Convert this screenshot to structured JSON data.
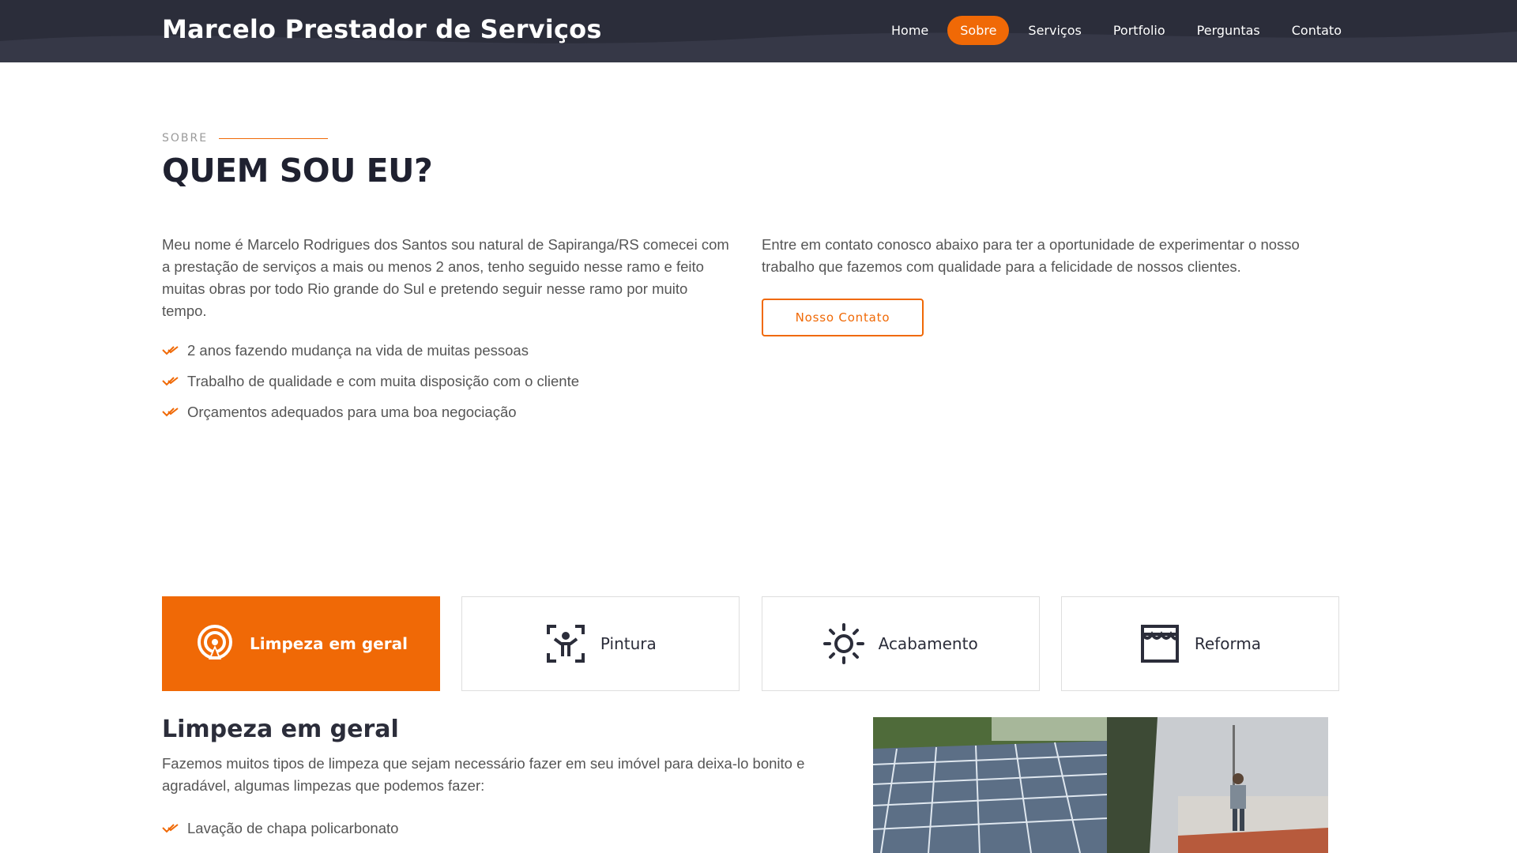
{
  "header": {
    "logo": "Marcelo Prestador de Serviços",
    "nav": [
      "Home",
      "Sobre",
      "Serviços",
      "Portfolio",
      "Perguntas",
      "Contato"
    ],
    "active_nav": "Sobre"
  },
  "about": {
    "label": "SOBRE",
    "title": "QUEM SOU EU?",
    "paragraph": "Meu nome é Marcelo Rodrigues dos Santos sou natural de Sapiranga/RS comecei com a prestação de serviços a mais ou menos 2 anos, tenho seguido nesse ramo e feito muitas obras por todo Rio grande do Sul e pretendo seguir nesse ramo por muito tempo.",
    "checks": [
      "2 anos fazendo mudança na vida de muitas pessoas",
      "Trabalho de qualidade e com muita disposição com o cliente",
      "Orçamentos adequados para uma boa negociação"
    ],
    "contact_text": "Entre em contato conosco abaixo para ter a oportunidade de experimentar o nosso trabalho que fazemos com qualidade para a felicidade de nossos clientes.",
    "contact_button": "Nosso Contato"
  },
  "services": {
    "tabs": [
      {
        "label": "Limpeza em geral",
        "icon": "broadcast-icon"
      },
      {
        "label": "Pintura",
        "icon": "scan-person-icon"
      },
      {
        "label": "Acabamento",
        "icon": "sun-icon"
      },
      {
        "label": "Reforma",
        "icon": "storefront-icon"
      }
    ],
    "active_tab": "Limpeza em geral",
    "content_title": "Limpeza em geral",
    "content_text": "Fazemos muitos tipos de limpeza que sejam necessário fazer em seu imóvel para deixa-lo bonito e agradável, algumas limpezas que podemos fazer:",
    "content_list": [
      "Lavação de chapa policarbonato"
    ]
  },
  "colors": {
    "accent": "#f06906",
    "header_bg": "#2b2d3a",
    "title": "#1f2130"
  }
}
